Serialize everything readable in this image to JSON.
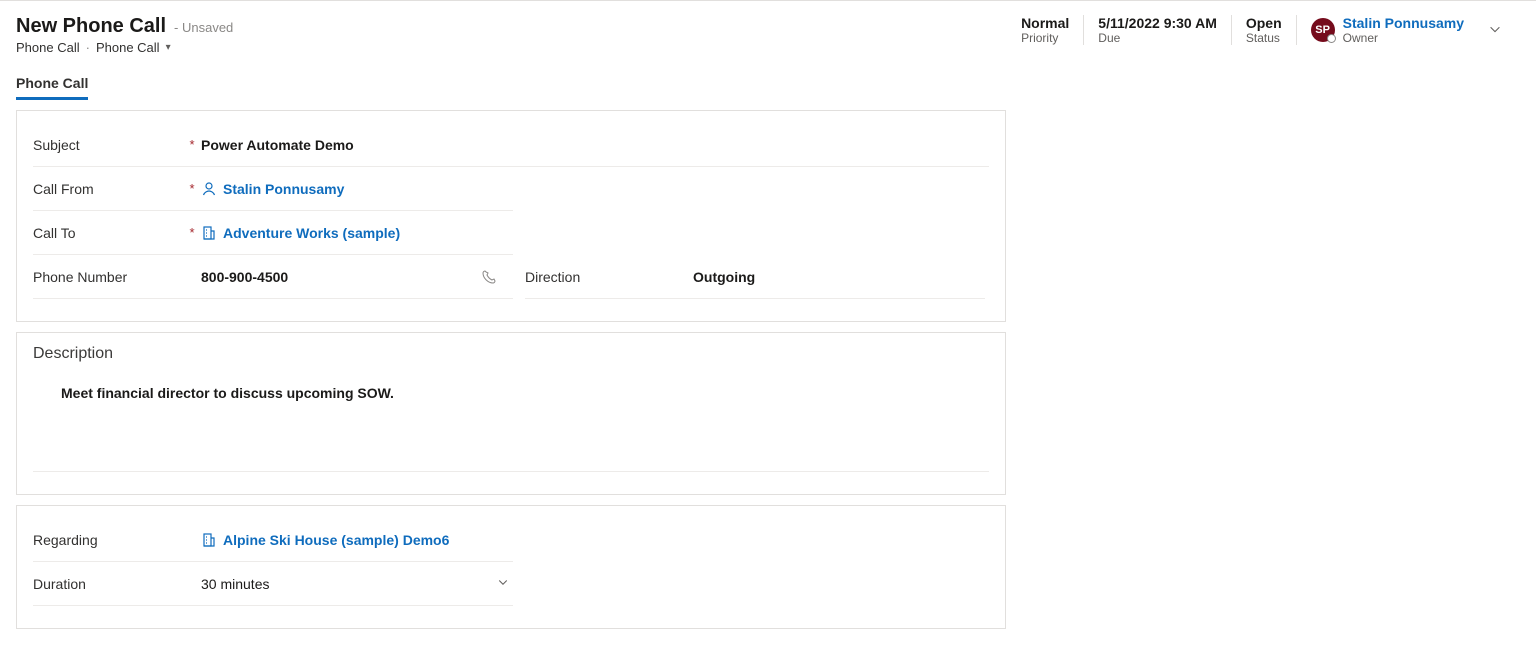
{
  "header": {
    "title": "New Phone Call",
    "saved_state": "- Unsaved",
    "breadcrumb1": "Phone Call",
    "breadcrumb_sep": "·",
    "breadcrumb2": "Phone Call"
  },
  "summary": {
    "priority_value": "Normal",
    "priority_label": "Priority",
    "due_value": "5/11/2022 9:30 AM",
    "due_label": "Due",
    "status_value": "Open",
    "status_label": "Status",
    "owner_initials": "SP",
    "owner_name": "Stalin Ponnusamy",
    "owner_label": "Owner"
  },
  "tabs": {
    "tab1": "Phone Call"
  },
  "fields": {
    "subject_label": "Subject",
    "subject_value": "Power Automate Demo",
    "callfrom_label": "Call From",
    "callfrom_value": "Stalin Ponnusamy",
    "callto_label": "Call To",
    "callto_value": "Adventure Works (sample)",
    "phone_label": "Phone Number",
    "phone_value": "800-900-4500",
    "direction_label": "Direction",
    "direction_value": "Outgoing",
    "description_heading": "Description",
    "description_value": "Meet financial director to discuss upcoming SOW.",
    "regarding_label": "Regarding",
    "regarding_value": "Alpine Ski House (sample) Demo6",
    "duration_label": "Duration",
    "duration_value": "30 minutes"
  }
}
